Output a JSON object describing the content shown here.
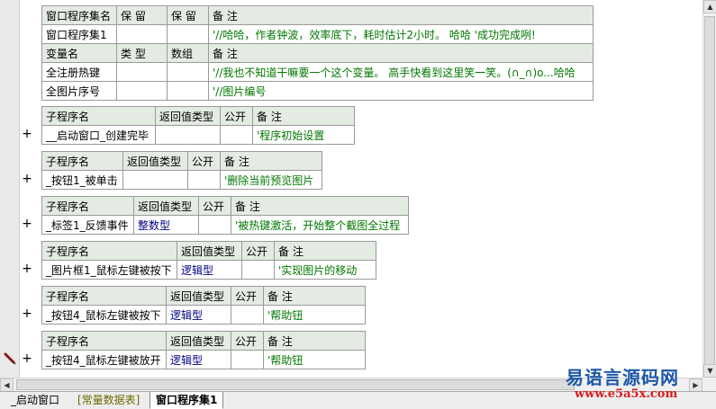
{
  "window_table": {
    "header1": [
      "窗口程序集名",
      "保 留",
      "保 留",
      "备 注"
    ],
    "row1": [
      "窗口程序集1",
      "",
      "",
      "'//哈哈，作者钟波，效率底下，耗时估计2小时。 哈哈 '成功完成咧!"
    ],
    "header2": [
      "变量名",
      "类 型",
      "数组",
      "备 注"
    ],
    "vars": [
      [
        "全注册热键",
        "",
        "",
        "'//我也不知道干嘛要一个这个变量。 高手快看到这里笑一笑。(∩_∩)o...哈哈"
      ],
      [
        "全图片序号",
        "",
        "",
        "'//图片编号"
      ]
    ]
  },
  "subroutines": [
    {
      "headers": [
        "子程序名",
        "返回值类型",
        "公开",
        "备 注"
      ],
      "name": "__启动窗口_创建完毕",
      "ret": "",
      "pub": "",
      "note": "'程序初始设置"
    },
    {
      "headers": [
        "子程序名",
        "返回值类型",
        "公开",
        "备 注"
      ],
      "name": "_按钮1_被单击",
      "ret": "",
      "pub": "",
      "note": "'删除当前预览图片"
    },
    {
      "headers": [
        "子程序名",
        "返回值类型",
        "公开",
        "备 注"
      ],
      "name": "_标签1_反馈事件",
      "ret": "整数型",
      "pub": "",
      "note": "'被热键激活，开始整个截图全过程"
    },
    {
      "headers": [
        "子程序名",
        "返回值类型",
        "公开",
        "备 注"
      ],
      "name": "_图片框1_鼠标左键被按下",
      "ret": "逻辑型",
      "pub": "",
      "note": "'实现图片的移动"
    },
    {
      "headers": [
        "子程序名",
        "返回值类型",
        "公开",
        "备 注"
      ],
      "name": "_按钮4_鼠标左键被按下",
      "ret": "逻辑型",
      "pub": "",
      "note": "'帮助钮"
    },
    {
      "headers": [
        "子程序名",
        "返回值类型",
        "公开",
        "备 注"
      ],
      "name": "_按钮4_鼠标左键被放开",
      "ret": "逻辑型",
      "pub": "",
      "note": "'帮助钮"
    }
  ],
  "expand_symbol": "+",
  "tabs": [
    "_启动窗口",
    "[常量数据表]",
    "窗口程序集1"
  ],
  "watermark": {
    "line1": "易语言源码网",
    "line2": "www.e5a5x.com"
  },
  "icons": [
    "pen-icon",
    "scroll-up-icon",
    "scroll-down-icon",
    "scroll-left-icon",
    "scroll-right-icon"
  ],
  "colors": {
    "header_bg": "#e3ebe3",
    "comment": "#007700",
    "type": "#000080",
    "watermark_blue": "#1c57a8",
    "watermark_red": "#d81e1e"
  }
}
